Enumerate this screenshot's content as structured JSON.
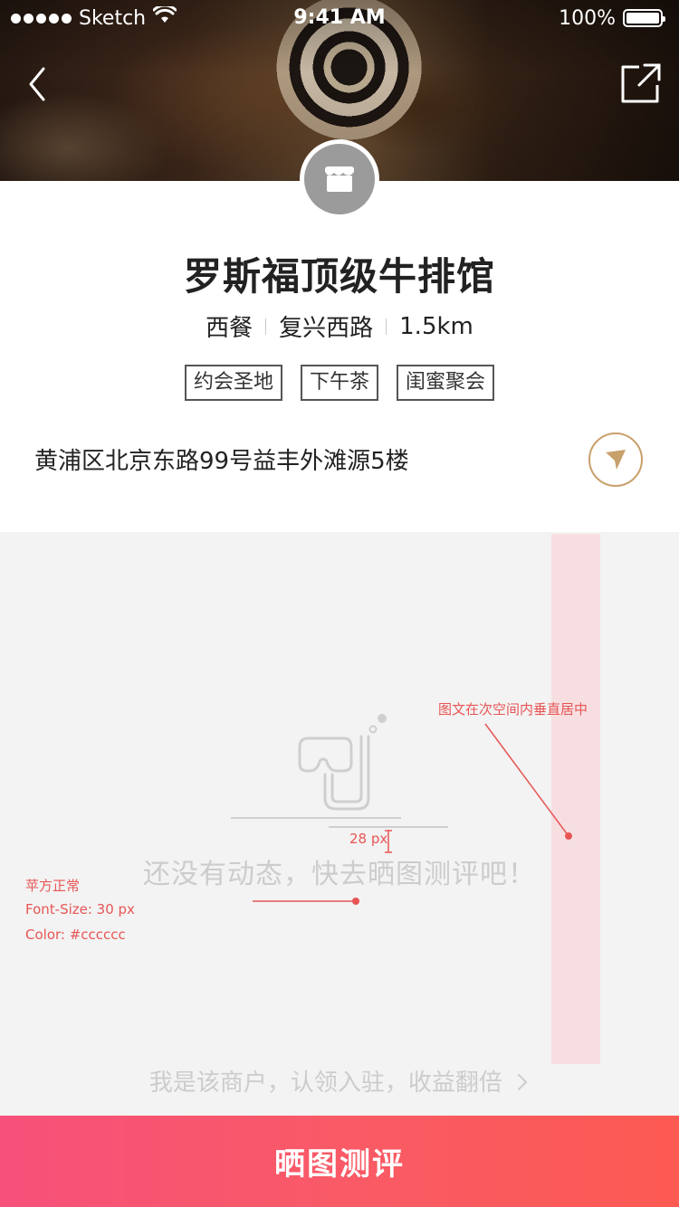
{
  "status_bar": {
    "carrier": "Sketch",
    "time": "9:41 AM",
    "battery": "100%"
  },
  "shop": {
    "name": "罗斯福顶级牛排馆",
    "cuisine": "西餐",
    "area": "复兴西路",
    "distance": "1.5km",
    "tags": [
      "约会圣地",
      "下午茶",
      "闺蜜聚会"
    ],
    "address": "黄浦区北京东路99号益丰外滩源5楼"
  },
  "empty_state": {
    "message": "还没有动态，快去晒图测评吧！",
    "claim_link": "我是该商户，认领入驻，收益翻倍"
  },
  "annotations": {
    "vertical_center_note": "图文在次空间内垂直居中",
    "spacing_note": "28 px",
    "font_family_note": "苹方正常",
    "font_size_note": "Font-Size: 30 px",
    "color_note": "Color: #cccccc"
  },
  "cta": {
    "label": "晒图测评"
  },
  "icons": {
    "back": "chevron-left-icon",
    "share": "share-icon",
    "shop": "shop-icon",
    "locate": "navigation-arrow-icon",
    "empty": "snorkel-mask-icon"
  },
  "colors": {
    "accent_gold": "#c8a06b",
    "cta_start": "#f7507a",
    "cta_end": "#fc5a52",
    "empty_text": "#cccccc",
    "annotation_red": "#e85555"
  }
}
